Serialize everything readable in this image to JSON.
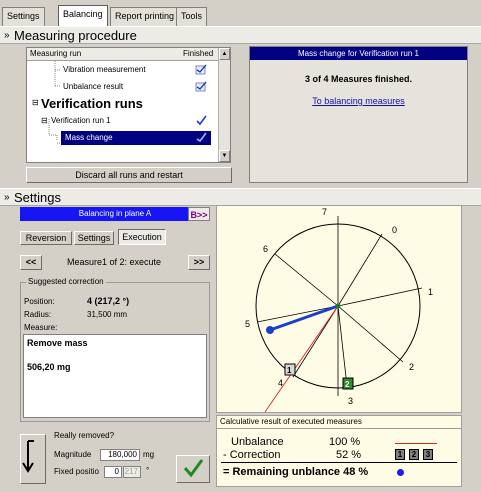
{
  "tabs": [
    "Settings",
    "Balancing",
    "Report printing",
    "Tools"
  ],
  "measuring_procedure": {
    "header": "Measuring procedure",
    "columns": {
      "run": "Measuring run",
      "finished": "Finished"
    },
    "rows": [
      {
        "label": "Vibration measurement"
      },
      {
        "label": "Unbalance result"
      },
      {
        "label": "Verification runs"
      },
      {
        "label": "Verification run 1"
      },
      {
        "label": "Mass change"
      }
    ],
    "discard_button": "Discard all runs and restart",
    "info_title": "Mass change for Verification run 1",
    "info_status": "3 of 4 Measures finished.",
    "info_link": "To balancing measures"
  },
  "settings": {
    "header": "Settings",
    "plane": "Balancing in plane A",
    "plane_next": "B>>",
    "subtabs": [
      "Reversion",
      "Settings",
      "Execution"
    ],
    "nav_prev": "<<",
    "nav_label": "Measure1 of 2: execute",
    "nav_next": ">>",
    "suggested_title": "Suggested correction",
    "position_label": "Position:",
    "position_value": "4 (217,2 °)",
    "radius_label": "Radius:",
    "radius_value": "31,500 mm",
    "measure_label": "Measure:",
    "measure_action": "Remove mass",
    "measure_value": "506,20 mg",
    "really_removed": "Really removed?",
    "magnitude_label": "Magnitude",
    "magnitude_value": "180,000",
    "magnitude_unit": "mg",
    "fixed_label": "Fixed positio",
    "fixed_value": "0",
    "fixed_angle": "217",
    "angle_unit": "°"
  },
  "polar": {
    "labels": [
      "0",
      "1",
      "2",
      "3",
      "4",
      "5",
      "6",
      "7"
    ],
    "marker1": "1",
    "marker2": "2"
  },
  "result": {
    "title": "Calculative result of executed measures",
    "unbalance_label": "Unbalance",
    "unbalance_value": "100 %",
    "correction_label": "- Correction",
    "correction_value": "52 %",
    "correction_markers": [
      "1",
      "2",
      "3"
    ],
    "remaining": "= Remaining unblance 48 %"
  },
  "colors": {
    "accent": "#000080",
    "plane_bar": "#1515f5",
    "vector": "#1a3fcc",
    "unbalance_line": "#e02020",
    "marker_green": "#2e8b2e"
  }
}
